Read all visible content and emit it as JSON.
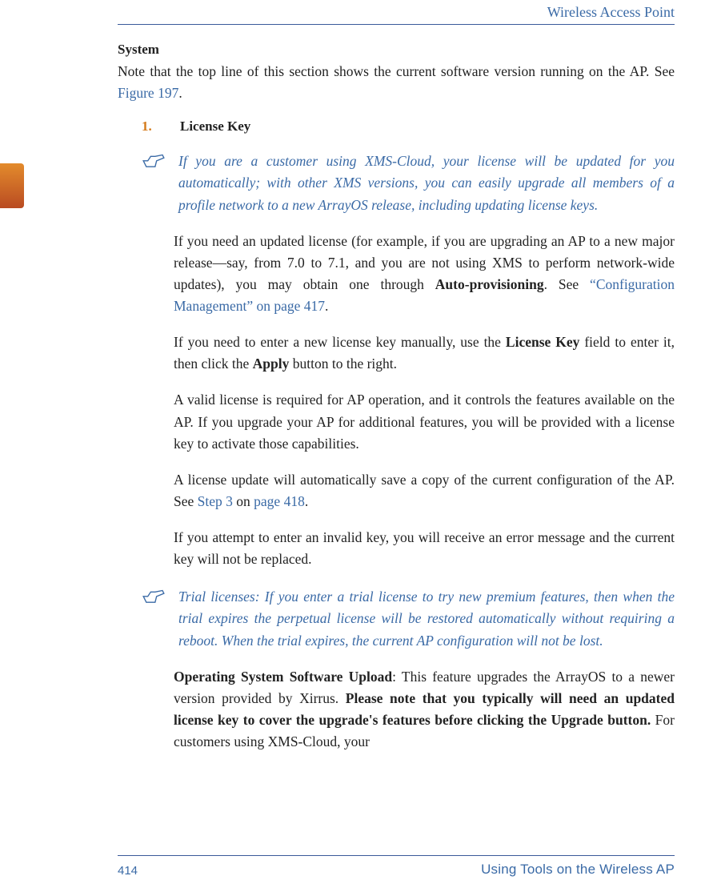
{
  "header": {
    "title": "Wireless Access Point"
  },
  "sidebar": {
    "tab_color": "#d47a1a"
  },
  "section": {
    "heading": "System",
    "intro_pre": "Note that the top line of this section shows the current software version running on the AP. See ",
    "intro_link": "Figure 197",
    "intro_post": "."
  },
  "list": {
    "item1": {
      "num": "1.",
      "label": "License Key"
    }
  },
  "note1": {
    "text": "If you are a customer using XMS-Cloud, your license will be updated for you automatically; with other XMS versions, you can easily upgrade all members of a profile network to a new ArrayOS release, including updating license keys."
  },
  "paras": {
    "p1_pre": "If you need an updated license (for example, if you are upgrading an AP to a new major release—say, from 7.0 to 7.1, and you are not using XMS to perform network-wide updates), you may obtain one through ",
    "p1_bold": "Auto-provisioning",
    "p1_mid": ". See ",
    "p1_link": "“Configuration Management” on page 417",
    "p1_post": ".",
    "p2_pre": "If you need to enter a new license key manually, use the ",
    "p2_b1": "License Key",
    "p2_mid": " field to enter it, then click the ",
    "p2_b2": "Apply",
    "p2_post": " button to the right.",
    "p3": "A valid license is required for AP operation, and it controls the features available on the AP. If you upgrade your AP for additional features, you will be provided with a license key to activate those capabilities.",
    "p4_pre": "A license update will automatically save a copy of the current configuration of the AP. See ",
    "p4_link1": "Step 3",
    "p4_on": " on ",
    "p4_link2": "page 418",
    "p4_post": ".",
    "p5": "If you attempt to enter an invalid key, you will receive an error message and the current key will not be replaced."
  },
  "note2": {
    "text": "Trial licenses: If you enter a trial license to try new premium features, then when the trial expires the perpetual license will be restored automatically without requiring a reboot. When the trial expires, the current AP configuration will not be lost."
  },
  "paras2": {
    "p6_b1": "Operating System Software Upload",
    "p6_mid1": ": This feature upgrades the ArrayOS to a newer version provided by Xirrus. ",
    "p6_b2": "Please note that you typically will need an updated license key to cover the upgrade's features before clicking the Upgrade button.",
    "p6_post": " For customers using XMS-Cloud, your"
  },
  "footer": {
    "page": "414",
    "right": "Using Tools on the Wireless AP"
  }
}
